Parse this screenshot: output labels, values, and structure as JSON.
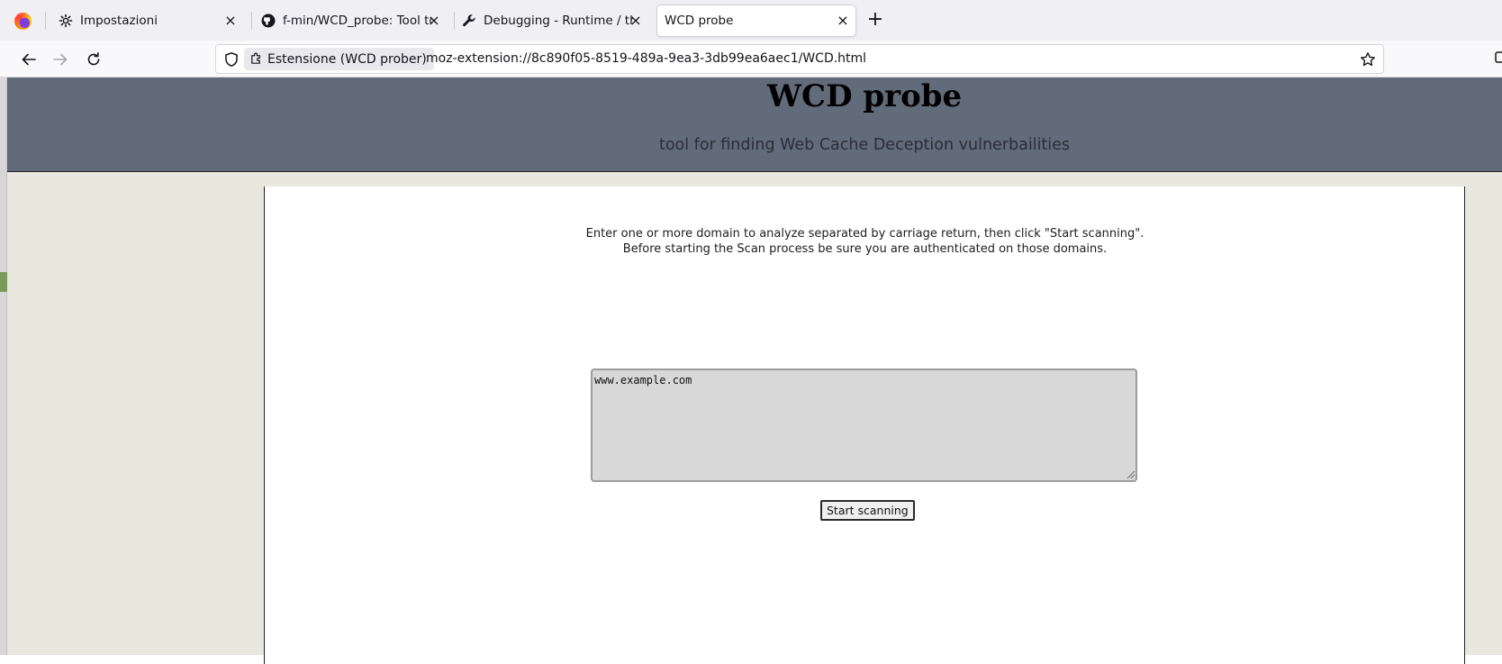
{
  "tabs": [
    {
      "title": "Impostazioni",
      "icon": "gear-icon"
    },
    {
      "title": "f-min/WCD_probe: Tool to f",
      "icon": "github-icon"
    },
    {
      "title": "Debugging - Runtime / this-",
      "icon": "wrench-icon"
    },
    {
      "title": "WCD probe",
      "icon": "none"
    }
  ],
  "urlbar": {
    "identity_label": "Estensione (WCD prober)",
    "url": "moz-extension://8c890f05-8519-489a-9ea3-3db99ea6aec1/WCD.html"
  },
  "page": {
    "title": "WCD probe",
    "subtitle": "tool for finding Web Cache Deception vulnerbailities",
    "instruction_line1": "Enter one or more domain to analyze separated by carriage return, then click \"Start scanning\".",
    "instruction_line2": "Before starting the Scan process be sure you are authenticated on those domains.",
    "domains_value": "www.example.com",
    "scan_button_label": "Start scanning"
  },
  "colors": {
    "header_bg": "#626b7a",
    "page_bg": "#e8e8de",
    "content_bg": "#ffffff",
    "textarea_bg": "#d8d8d8"
  }
}
